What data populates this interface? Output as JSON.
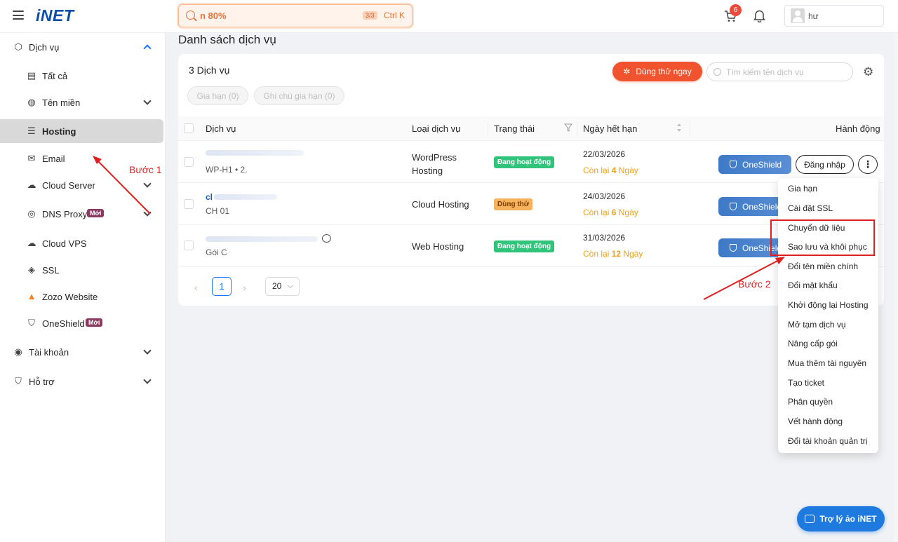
{
  "header": {
    "logo_main": "iNET",
    "search_value": "n 80%",
    "search_count": "3/3",
    "search_shortcut": "Ctrl K",
    "cart_badge": "6",
    "user_name": "hư"
  },
  "sidebar": {
    "items": [
      {
        "label": "Dịch vụ",
        "icon": "cube-icon"
      },
      {
        "label": "Tất cả",
        "icon": "list-icon"
      },
      {
        "label": "Tên miền",
        "icon": "globe-icon"
      },
      {
        "label": "Hosting",
        "icon": "server-icon"
      },
      {
        "label": "Email",
        "icon": "mail-icon"
      },
      {
        "label": "Cloud Server",
        "icon": "cloud-icon"
      },
      {
        "label": "DNS Proxy",
        "icon": "dns-icon",
        "badge": "Mới"
      },
      {
        "label": "Cloud VPS",
        "icon": "cloud-vps-icon"
      },
      {
        "label": "SSL",
        "icon": "ssl-icon"
      },
      {
        "label": "Zozo Website",
        "icon": "zozo-icon"
      },
      {
        "label": "OneShield",
        "icon": "shield-icon",
        "badge": "Mới"
      },
      {
        "label": "Tài khoản",
        "icon": "user-circle-icon"
      },
      {
        "label": "Hỗ trợ",
        "icon": "support-icon"
      }
    ]
  },
  "main": {
    "title": "Danh sách dịch vụ",
    "count": "3 Dịch vụ",
    "trial_button": "Dùng thử ngay",
    "search_placeholder": "Tìm kiếm tên dịch vụ",
    "chips": [
      "Gia hạn (0)",
      "Ghi chú gia hạn (0)"
    ],
    "columns": [
      "Dịch vụ",
      "Loại dịch vụ",
      "Trạng thái",
      "Ngày hết hạn",
      "Hành động"
    ],
    "rows": [
      {
        "name": "",
        "sub": "WP-H1 • 2.",
        "type": "WordPress Hosting",
        "status": "Đang hoạt động",
        "date": "22/03/2026",
        "remain_prefix": "Còn lại",
        "remain_num": "4",
        "remain_unit": "Ngày"
      },
      {
        "name": "cl",
        "sub": "CH 01",
        "type": "Cloud Hosting",
        "status": "Dùng thử",
        "date": "24/03/2026",
        "remain_prefix": "Còn lại",
        "remain_num": "6",
        "remain_unit": "Ngày"
      },
      {
        "name": "",
        "sub": "Gói C",
        "type": "Web Hosting",
        "status": "Đang hoạt động",
        "date": "31/03/2026",
        "remain_prefix": "Còn lại",
        "remain_num": "12",
        "remain_unit": "Ngày"
      }
    ],
    "oneshield_label": "OneShield",
    "login_label": "Đăng nhập",
    "more_label": "⋮",
    "pager": {
      "current": "1",
      "size": "20"
    }
  },
  "menu": {
    "items": [
      "Gia hạn",
      "Cài đặt SSL",
      "Chuyển dữ liệu",
      "Sao lưu và khôi phục",
      "Đổi tên miền chính",
      "Đổi mật khẩu",
      "Khởi động lại Hosting",
      "Mở tạm dịch vụ",
      "Nâng cấp gói",
      "Mua thêm tài nguyên",
      "Tạo ticket",
      "Phân quyền",
      "Vết hành động",
      "Đổi tài khoản quản trị"
    ]
  },
  "annotations": {
    "step1": "Bước 1",
    "step2": "Bước 2"
  },
  "assistant": {
    "label": "Trợ lý ảo iNET"
  },
  "colors": {
    "brand": "#0d4ea6",
    "accent": "#f0532e",
    "status_active": "#2fc47a",
    "status_trial": "#f7b25e",
    "annotation": "#e02020"
  }
}
